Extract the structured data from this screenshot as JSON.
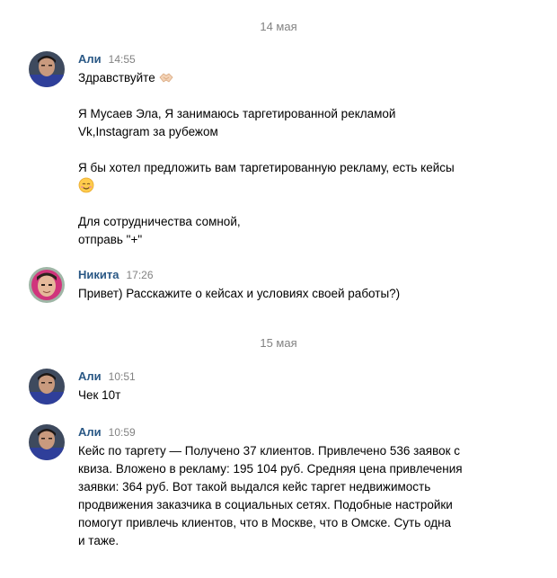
{
  "dates": {
    "first": "14 мая",
    "second": "15 мая"
  },
  "messages": [
    {
      "author": "Али",
      "time": "14:55",
      "lines": [
        "Здравствуйте",
        "",
        "Я Мусаев Эла, Я занимаюсь таргетированной рекламой",
        "Vk,Instagram за рубежом",
        "",
        "Я бы хотел предложить вам таргетированную рекламу, есть кейсы",
        "",
        "",
        "Для сотрудничества сомной,",
        "отправь \"+\""
      ]
    },
    {
      "author": "Никита",
      "time": "17:26",
      "lines": [
        "Привет) Расскажите о кейсах и условиях своей работы?)"
      ]
    },
    {
      "author": "Али",
      "time": "10:51",
      "lines": [
        "Чек 10т"
      ]
    },
    {
      "author": "Али",
      "time": "10:59",
      "lines": [
        "Кейс по таргету — Получено 37 клиентов. Привлечено 536 заявок с",
        "квиза. Вложено в рекламу: 195 104 руб. Средняя цена привлечения",
        "заявки: 364 руб. Вот такой выдался кейс таргет недвижимость",
        "продвижения заказчика в социальных сетях. Подобные настройки",
        "помогут привлечь клиентов, что в Москве, что в Омске. Суть одна",
        "и таже."
      ]
    }
  ],
  "colors": {
    "author": "#2a5885",
    "time": "#828282",
    "date_separator": "#828282",
    "text": "#000000"
  },
  "icons": {
    "greeting_emoji": "handshake-emoji",
    "smile_emoji": "smiling-face-emoji"
  }
}
